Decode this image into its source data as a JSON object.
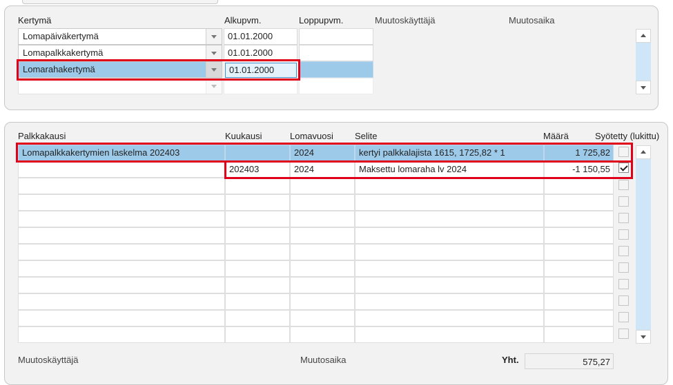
{
  "top_panel": {
    "headers": {
      "kertyma": "Kertymä",
      "alkupvm": "Alkupvm.",
      "loppupvm": "Loppupvm.",
      "muutoskayttaja": "Muutoskäyttäjä",
      "muutosaika": "Muutosaika"
    },
    "rows": [
      {
        "kertyma": "Lomapäiväkertymä",
        "alkupvm": "01.01.2000",
        "loppupvm": ""
      },
      {
        "kertyma": "Lomapalkkakertymä",
        "alkupvm": "01.01.2000",
        "loppupvm": ""
      },
      {
        "kertyma": "Lomarahakertymä",
        "alkupvm": "01.01.2000",
        "loppupvm": ""
      },
      {
        "kertyma": "",
        "alkupvm": "",
        "loppupvm": ""
      }
    ]
  },
  "bottom_panel": {
    "headers": {
      "palkkakausi": "Palkkakausi",
      "kuukausi": "Kuukausi",
      "lomavuosi": "Lomavuosi",
      "selite": "Selite",
      "maara": "Määrä",
      "syotetty": "Syötetty (lukittu)"
    },
    "rows": [
      {
        "palkkakausi": "Lomapalkkakertymien laskelma 202403",
        "kuukausi": "",
        "lomavuosi": "2024",
        "selite": "kertyi palkkalajista 1615, 1725,82 * 1",
        "maara": "1 725,82",
        "syotetty": false
      },
      {
        "palkkakausi": "",
        "kuukausi": "202403",
        "lomavuosi": "2024",
        "selite": "Maksettu lomaraha lv 2024",
        "maara": "-1 150,55",
        "syotetty": true
      }
    ],
    "footer": {
      "muutoskayttaja": "Muutoskäyttäjä",
      "muutosaika": "Muutosaika",
      "yht_label": "Yht.",
      "yht_value": "575,27"
    }
  },
  "colors": {
    "selected_row": "#9ecae9",
    "highlight_border": "#e0001a",
    "scrollbar_track": "#cfe6f8"
  }
}
